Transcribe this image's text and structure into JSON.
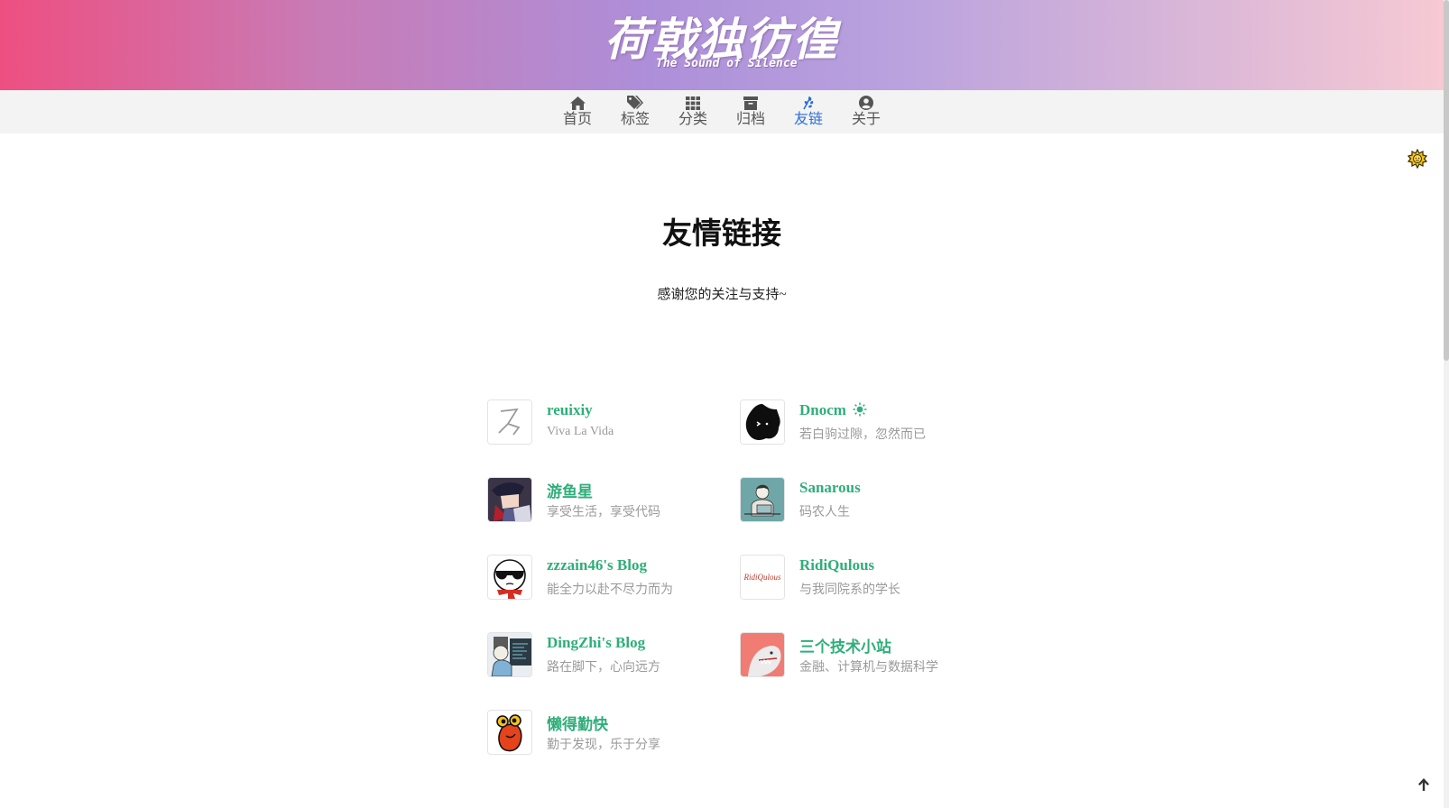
{
  "header": {
    "logo_cn": "荷戟独彷徨",
    "logo_en": "The Sound of Silence"
  },
  "nav": {
    "items": [
      {
        "label": "首页",
        "icon": "home-icon"
      },
      {
        "label": "标签",
        "icon": "tags-icon"
      },
      {
        "label": "分类",
        "icon": "grid-icon"
      },
      {
        "label": "归档",
        "icon": "archive-icon"
      },
      {
        "label": "友链",
        "icon": "leaf-icon",
        "active": true
      },
      {
        "label": "关于",
        "icon": "user-circle-icon"
      }
    ]
  },
  "theme_toggle": {
    "icon": "sun-icon"
  },
  "page": {
    "title": "友情链接",
    "subtitle": "感谢您的关注与支持~"
  },
  "links": [
    {
      "name": "reuixiy",
      "desc": "Viva La Vida",
      "avatar": "reuixiy-avatar"
    },
    {
      "name": "Dnocm",
      "desc": "若白驹过隙，忽然而已",
      "avatar": "dnocm-avatar",
      "badge": "sun-icon"
    },
    {
      "name": "游鱼星",
      "desc": "享受生活，享受代码",
      "avatar": "youyuxing-avatar"
    },
    {
      "name": "Sanarous",
      "desc": "码农人生",
      "avatar": "sanarous-avatar"
    },
    {
      "name": "zzzain46's Blog",
      "desc": "能全力以赴不尽力而为",
      "avatar": "zzzain46-avatar"
    },
    {
      "name": "RidiQulous",
      "desc": "与我同院系的学长",
      "avatar": "ridiqulous-avatar",
      "avatar_text": "RidiQulous"
    },
    {
      "name": "DingZhi's Blog",
      "desc": "路在脚下，心向远方",
      "avatar": "dingzhi-avatar"
    },
    {
      "name": "三个技术小站",
      "desc": "金融、计算机与数据科学",
      "avatar": "sange-avatar"
    },
    {
      "name": "懒得勤快",
      "desc": "勤于发现，乐于分享",
      "avatar": "landeqinkuai-avatar"
    }
  ],
  "colors": {
    "link_name": "#2fae7a",
    "nav_active": "#2b6ed9",
    "banner_start": "#ee4f81",
    "banner_end": "#f6c9d3"
  },
  "back_to_top": {
    "icon": "arrow-up-icon"
  }
}
